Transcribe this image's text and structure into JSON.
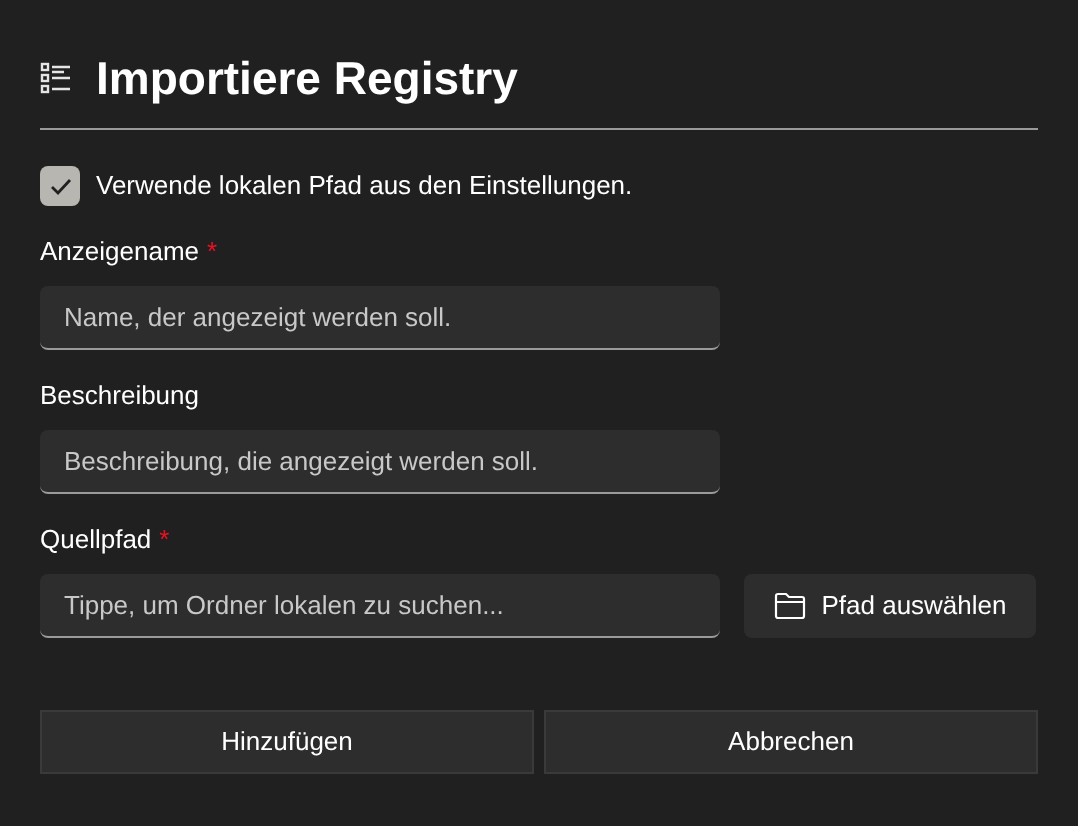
{
  "dialog": {
    "title": "Importiere Registry"
  },
  "checkbox": {
    "label": "Verwende lokalen Pfad aus den Einstellungen.",
    "checked": true
  },
  "fields": [
    {
      "label": "Anzeigename",
      "required_mark": "*",
      "placeholder": "Name, der angezeigt werden soll."
    },
    {
      "label": "Beschreibung",
      "placeholder": "Beschreibung, die angezeigt werden soll."
    },
    {
      "label": "Quellpfad",
      "required_mark": "*",
      "placeholder": "Tippe, um Ordner lokalen zu suchen...",
      "browse_button": "Pfad auswählen"
    }
  ],
  "buttons": [
    "Hinzufügen",
    "Abbrechen"
  ]
}
